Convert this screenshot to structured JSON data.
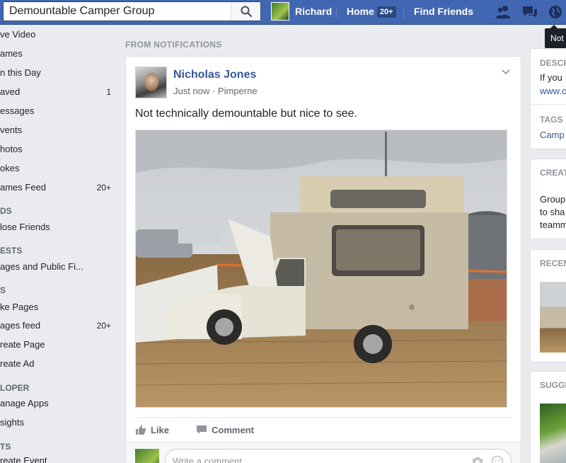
{
  "topbar": {
    "search_value": "Demountable Camper Group",
    "search_icon": "search-icon",
    "user_name": "Richard",
    "home_label": "Home",
    "home_badge": "20+",
    "find_friends_label": "Find Friends",
    "icons": [
      "friend-requests-icon",
      "messages-icon",
      "notifications-globe-icon"
    ],
    "tooltip_text": "Not"
  },
  "sidebar": {
    "items": [
      {
        "label": "ve Video",
        "count": ""
      },
      {
        "label": "ames",
        "count": ""
      },
      {
        "label": "n this Day",
        "count": ""
      },
      {
        "label": "aved",
        "count": "1"
      },
      {
        "label": "essages",
        "count": ""
      },
      {
        "label": "vents",
        "count": ""
      },
      {
        "label": "hotos",
        "count": ""
      },
      {
        "label": "okes",
        "count": ""
      },
      {
        "label": "ames Feed",
        "count": "20+"
      }
    ],
    "head_friends": "DS",
    "friends_items": [
      {
        "label": "lose Friends"
      }
    ],
    "head_interests": "ESTS",
    "interests_items": [
      {
        "label": "ages and Public Fi..."
      }
    ],
    "head_pages": "S",
    "pages_items": [
      {
        "label": "ke Pages",
        "count": ""
      },
      {
        "label": "ages feed",
        "count": "20+"
      },
      {
        "label": "reate Page",
        "count": ""
      },
      {
        "label": "reate Ad",
        "count": ""
      }
    ],
    "head_developer": "LOPER",
    "developer_items": [
      {
        "label": "anage Apps"
      },
      {
        "label": "sights"
      }
    ],
    "head_events": "TS",
    "events_items": [
      {
        "label": "reate Event"
      }
    ]
  },
  "feed": {
    "section_label": "FROM NOTIFICATIONS",
    "post": {
      "author": "Nicholas Jones",
      "time": "Just now",
      "separator": "·",
      "location": "Pimperne",
      "text": "Not technically demountable but nice to see.",
      "like_label": "Like",
      "comment_label": "Comment",
      "comment_placeholder": "Write a comment..."
    }
  },
  "right": {
    "desc_head": "DESCR",
    "desc_text": "If you",
    "desc_link": "www.c",
    "tags_head": "TAGS",
    "tags_link": "Camp",
    "create_head": "CREAT",
    "create_lines": [
      "Group",
      "to sha",
      "teamm"
    ],
    "recent_head": "RECEN",
    "sugg_head": "SUGGE"
  },
  "colors": {
    "topbar": "#4267b2",
    "link": "#365899",
    "background": "#e9ebee"
  }
}
